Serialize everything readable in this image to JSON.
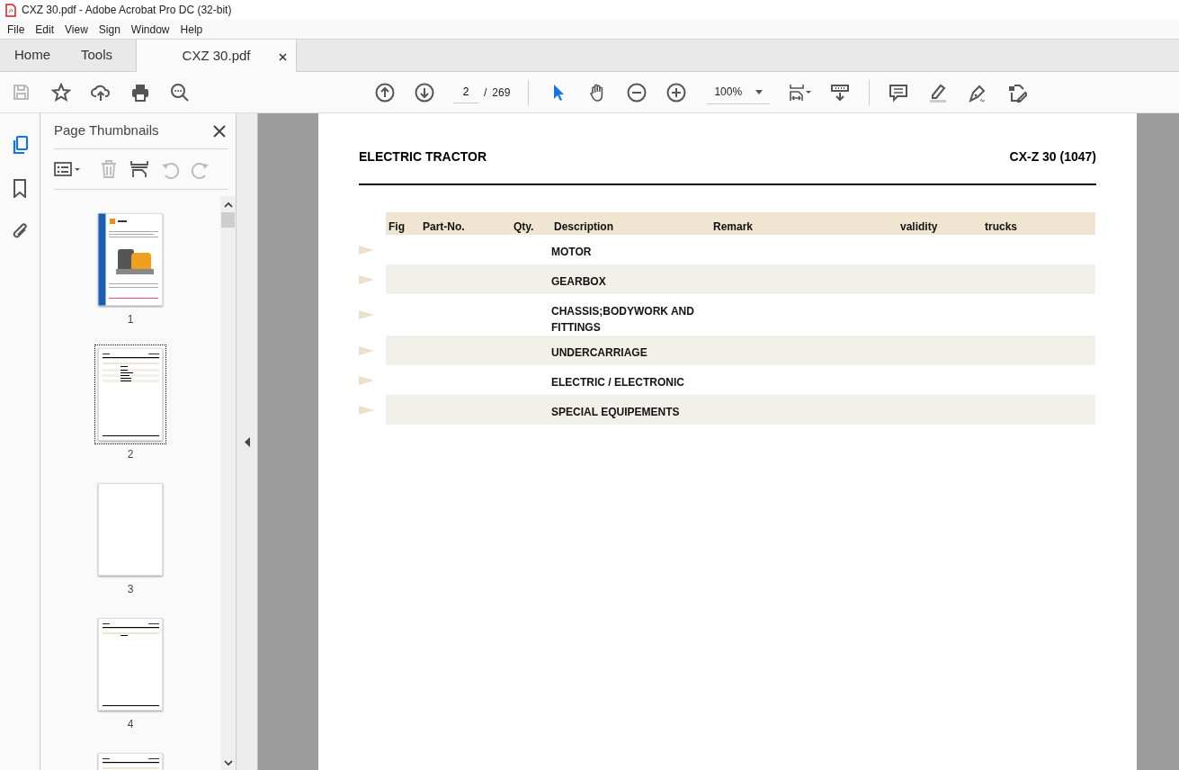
{
  "window": {
    "title": "CXZ 30.pdf - Adobe Acrobat Pro DC (32-bit)"
  },
  "menu": [
    "File",
    "Edit",
    "View",
    "Sign",
    "Window",
    "Help"
  ],
  "tabs": [
    {
      "label": "Home",
      "selected": false
    },
    {
      "label": "Tools",
      "selected": false
    },
    {
      "label": "CXZ 30.pdf",
      "selected": true,
      "closable": true
    }
  ],
  "toolbar": {
    "page_current": "2",
    "page_separator": "/",
    "page_total": "269",
    "zoom": "100%"
  },
  "rail": [
    {
      "kind": "pages",
      "selected": true
    },
    {
      "kind": "bookmarks",
      "selected": false
    },
    {
      "kind": "attachments",
      "selected": false
    }
  ],
  "sidebar": {
    "title": "Page Thumbnails",
    "thumbnails": [
      {
        "label": "1",
        "kind": "cover",
        "selected": false
      },
      {
        "label": "2",
        "kind": "index",
        "selected": true
      },
      {
        "label": "3",
        "kind": "blank",
        "selected": false
      },
      {
        "label": "4",
        "kind": "list",
        "selected": false
      },
      {
        "kind": "list",
        "selected": false
      }
    ]
  },
  "document": {
    "title": "ELECTRIC TRACTOR",
    "model": "CX-Z 30 (1047)",
    "columns": [
      "Fig",
      "Part-No.",
      "Qty.",
      "Description",
      "Remark",
      "validity",
      "trucks"
    ],
    "rows": [
      {
        "description": "MOTOR",
        "shaded": false
      },
      {
        "description": "GEARBOX",
        "shaded": true
      },
      {
        "description": "CHASSIS;BODYWORK AND FITTINGS",
        "shaded": false
      },
      {
        "description": "UNDERCARRIAGE",
        "shaded": true
      },
      {
        "description": "ELECTRIC / ELECTRONIC",
        "shaded": false
      },
      {
        "description": "SPECIAL EQUIPEMENTS",
        "shaded": true
      }
    ]
  }
}
